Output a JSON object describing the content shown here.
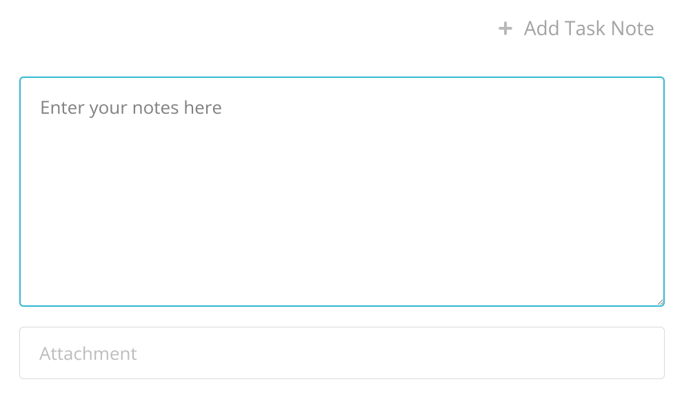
{
  "header": {
    "title": "Add Task Note"
  },
  "notes": {
    "placeholder": "Enter your notes here",
    "value": ""
  },
  "attachment": {
    "placeholder": "Attachment",
    "value": ""
  }
}
